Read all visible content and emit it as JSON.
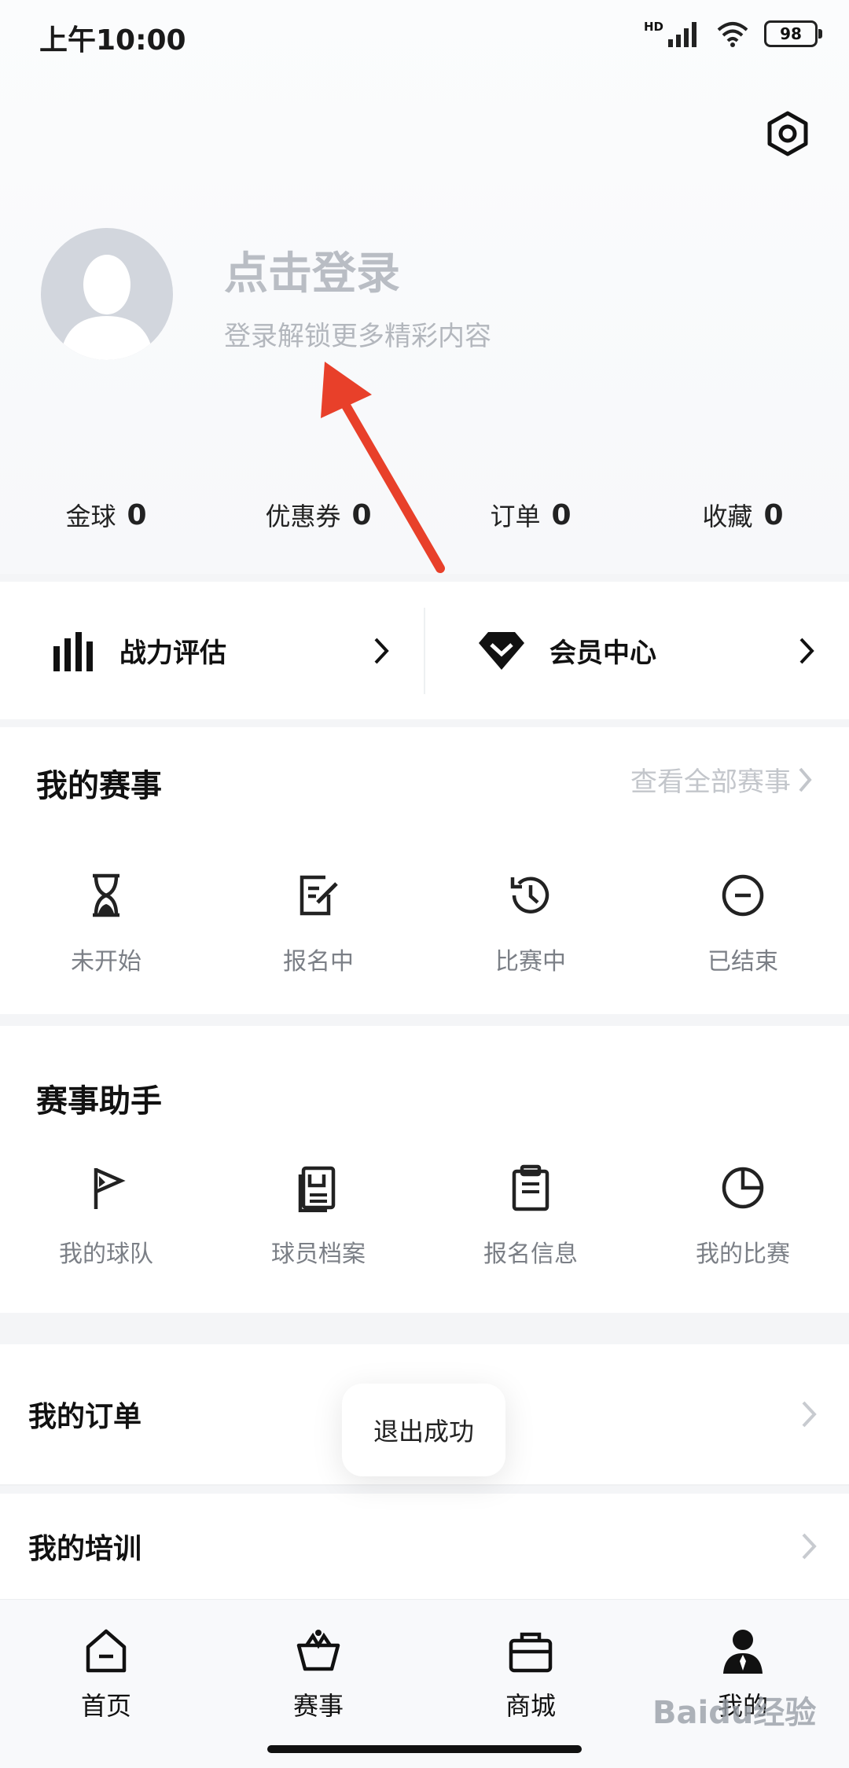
{
  "status": {
    "time": "上午10:00",
    "battery": "98",
    "network": "HD"
  },
  "profile": {
    "login_title": "点击登录",
    "login_subtitle": "登录解锁更多精彩内容"
  },
  "stats": [
    {
      "label": "金球",
      "value": "0"
    },
    {
      "label": "优惠券",
      "value": "0"
    },
    {
      "label": "订单",
      "value": "0"
    },
    {
      "label": "收藏",
      "value": "0"
    }
  ],
  "quick_links": [
    {
      "label": "战力评估",
      "icon": "bar-chart-icon"
    },
    {
      "label": "会员中心",
      "icon": "diamond-icon"
    }
  ],
  "my_events": {
    "title": "我的赛事",
    "more": "查看全部赛事",
    "items": [
      {
        "label": "未开始",
        "icon": "hourglass-icon"
      },
      {
        "label": "报名中",
        "icon": "edit-note-icon"
      },
      {
        "label": "比赛中",
        "icon": "history-clock-icon"
      },
      {
        "label": "已结束",
        "icon": "minus-circle-icon"
      }
    ]
  },
  "assistant": {
    "title": "赛事助手",
    "items": [
      {
        "label": "我的球队",
        "icon": "flag-icon"
      },
      {
        "label": "球员档案",
        "icon": "archive-icon"
      },
      {
        "label": "报名信息",
        "icon": "clipboard-icon"
      },
      {
        "label": "我的比赛",
        "icon": "pie-icon"
      }
    ]
  },
  "lists": [
    {
      "label": "我的订单"
    },
    {
      "label": "我的培训"
    }
  ],
  "toast": "退出成功",
  "tabs": [
    {
      "label": "首页",
      "icon": "home-icon"
    },
    {
      "label": "赛事",
      "icon": "crown-basket-icon"
    },
    {
      "label": "商城",
      "icon": "shopping-bag-icon"
    },
    {
      "label": "我的",
      "icon": "person-icon"
    }
  ],
  "watermark": "Baidu经验"
}
